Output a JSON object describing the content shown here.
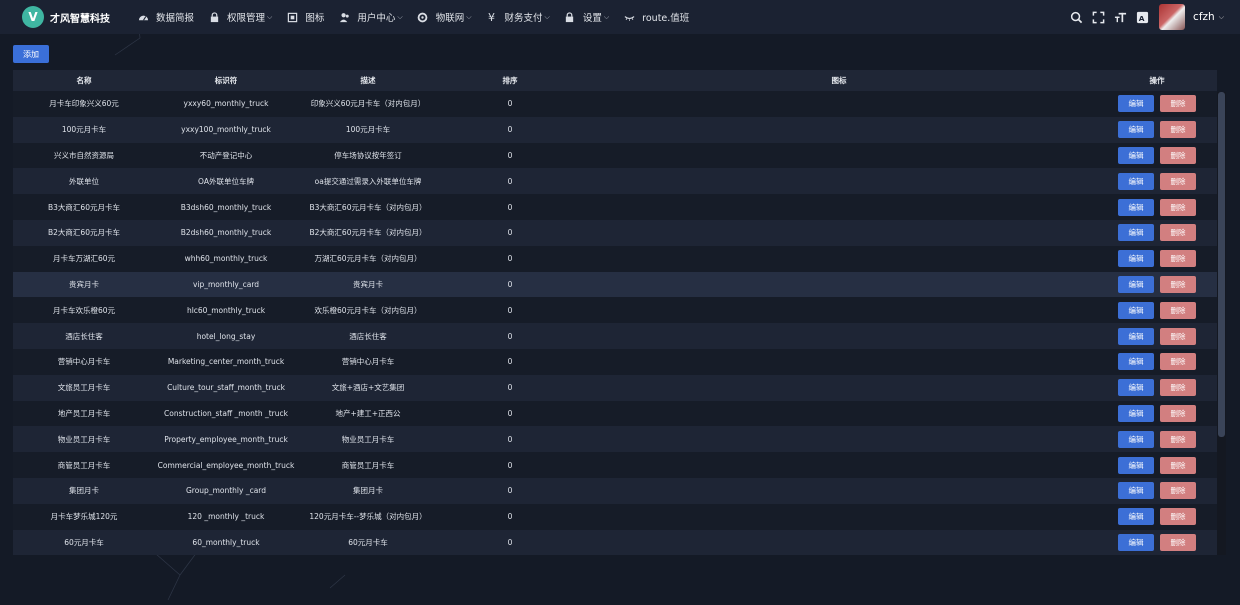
{
  "brand": {
    "logo_letter": "V",
    "name": "才风智慧科技"
  },
  "nav": [
    {
      "label": "数据简报",
      "icon": "dashboard-icon",
      "dropdown": false
    },
    {
      "label": "权限管理",
      "icon": "lock-icon",
      "dropdown": true
    },
    {
      "label": "图标",
      "icon": "picture-icon",
      "dropdown": false
    },
    {
      "label": "用户中心",
      "icon": "users-icon",
      "dropdown": true
    },
    {
      "label": "物联网",
      "icon": "gear-icon",
      "dropdown": true
    },
    {
      "label": "财务支付",
      "icon": "yen-icon",
      "dropdown": true
    },
    {
      "label": "设置",
      "icon": "lock-icon",
      "dropdown": true
    },
    {
      "label": "route.值班",
      "icon": "eye-closed-icon",
      "dropdown": false
    }
  ],
  "user": {
    "name": "cfzh"
  },
  "toolbar": {
    "add_label": "添加"
  },
  "table": {
    "columns": [
      "名称",
      "标识符",
      "描述",
      "排序",
      "图标",
      "操作"
    ],
    "edit_label": "编辑",
    "delete_label": "删除",
    "rows": [
      [
        "月卡车印象兴义60元",
        "yxxy60_monthly_truck",
        "印象兴义60元月卡车（对内包月）",
        "0",
        ""
      ],
      [
        "100元月卡车",
        "yxxy100_monthly_truck",
        "100元月卡车",
        "0",
        ""
      ],
      [
        "兴义市自然资源局",
        "不动产登记中心",
        "停车场协议按年签订",
        "0",
        ""
      ],
      [
        "外联单位",
        "OA外联单位车牌",
        "oa提交通过需录入外联单位车牌",
        "0",
        ""
      ],
      [
        "B3大商汇60元月卡车",
        "B3dsh60_monthly_truck",
        "B3大商汇60元月卡车（对内包月）",
        "0",
        ""
      ],
      [
        "B2大商汇60元月卡车",
        "B2dsh60_monthly_truck",
        "B2大商汇60元月卡车（对内包月）",
        "0",
        ""
      ],
      [
        "月卡车万湖汇60元",
        "whh60_monthly_truck",
        "万湖汇60元月卡车（对内包月）",
        "0",
        ""
      ],
      [
        "贵宾月卡",
        "vip_monthly_card",
        "贵宾月卡",
        "0",
        ""
      ],
      [
        "月卡车欢乐橙60元",
        "hlc60_monthly_truck",
        "欢乐橙60元月卡车（对内包月）",
        "0",
        ""
      ],
      [
        "酒店长住客",
        "hotel_long_stay",
        "酒店长住客",
        "0",
        ""
      ],
      [
        "营销中心月卡车",
        "Marketing_center_month_truck",
        "营销中心月卡车",
        "0",
        ""
      ],
      [
        "文旅员工月卡车",
        "Culture_tour_staff_month_truck",
        "文旅+酒店+文艺集团",
        "0",
        ""
      ],
      [
        "地产员工月卡车",
        "Construction_staff _month _truck",
        "地产+建工+正西公",
        "0",
        ""
      ],
      [
        "物业员工月卡车",
        "Property_employee_month_truck",
        "物业员工月卡车",
        "0",
        ""
      ],
      [
        "商管员工月卡车",
        "Commercial_employee_month_truck",
        "商管员工月卡车",
        "0",
        ""
      ],
      [
        "集团月卡",
        "Group_monthly _card",
        "集团月卡",
        "0",
        ""
      ],
      [
        "月卡车梦乐城120元",
        "120 _monthly _truck",
        "120元月卡车--梦乐城（对内包月）",
        "0",
        ""
      ],
      [
        "60元月卡车",
        "60_monthly_truck",
        "60元月卡车",
        "0",
        ""
      ]
    ],
    "highlighted_row": 7
  },
  "colors": {
    "background": "#141a26",
    "topbar": "#1b2232",
    "primary": "#3c6fd6",
    "danger": "#d27f80",
    "logo": "#3fb6a2"
  }
}
